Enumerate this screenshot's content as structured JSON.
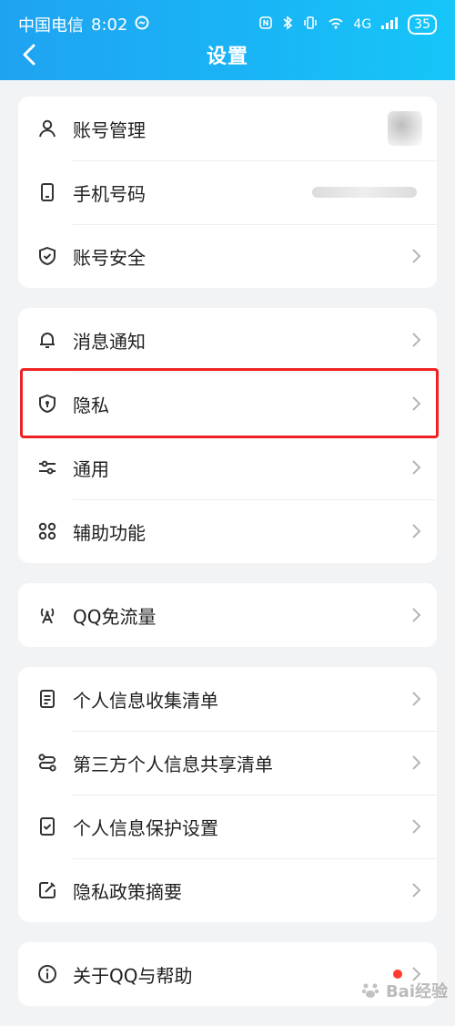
{
  "status_bar": {
    "carrier": "中国电信",
    "time": "8:02",
    "network": "4G",
    "battery": "35"
  },
  "header": {
    "title": "设置"
  },
  "sections": [
    {
      "items": [
        {
          "label": "账号管理",
          "icon": "user-icon"
        },
        {
          "label": "手机号码",
          "icon": "phone-icon"
        },
        {
          "label": "账号安全",
          "icon": "shield-check-icon"
        }
      ]
    },
    {
      "items": [
        {
          "label": "消息通知",
          "icon": "bell-icon"
        },
        {
          "label": "隐私",
          "icon": "privacy-shield-icon"
        },
        {
          "label": "通用",
          "icon": "sliders-icon"
        },
        {
          "label": "辅助功能",
          "icon": "grid-icon"
        }
      ]
    },
    {
      "items": [
        {
          "label": "QQ免流量",
          "icon": "signal-tower-icon"
        }
      ]
    },
    {
      "items": [
        {
          "label": "个人信息收集清单",
          "icon": "document-list-icon"
        },
        {
          "label": "第三方个人信息共享清单",
          "icon": "share-icon"
        },
        {
          "label": "个人信息保护设置",
          "icon": "check-doc-icon"
        },
        {
          "label": "隐私政策摘要",
          "icon": "edit-icon"
        }
      ]
    },
    {
      "items": [
        {
          "label": "关于QQ与帮助",
          "icon": "info-icon"
        }
      ]
    }
  ],
  "watermark": {
    "text": "Bai经验"
  },
  "colors": {
    "header_gradient_start": "#1fa3f1",
    "header_gradient_end": "#16c6f9",
    "highlight": "#e22222",
    "badge": "#ff3b30"
  }
}
